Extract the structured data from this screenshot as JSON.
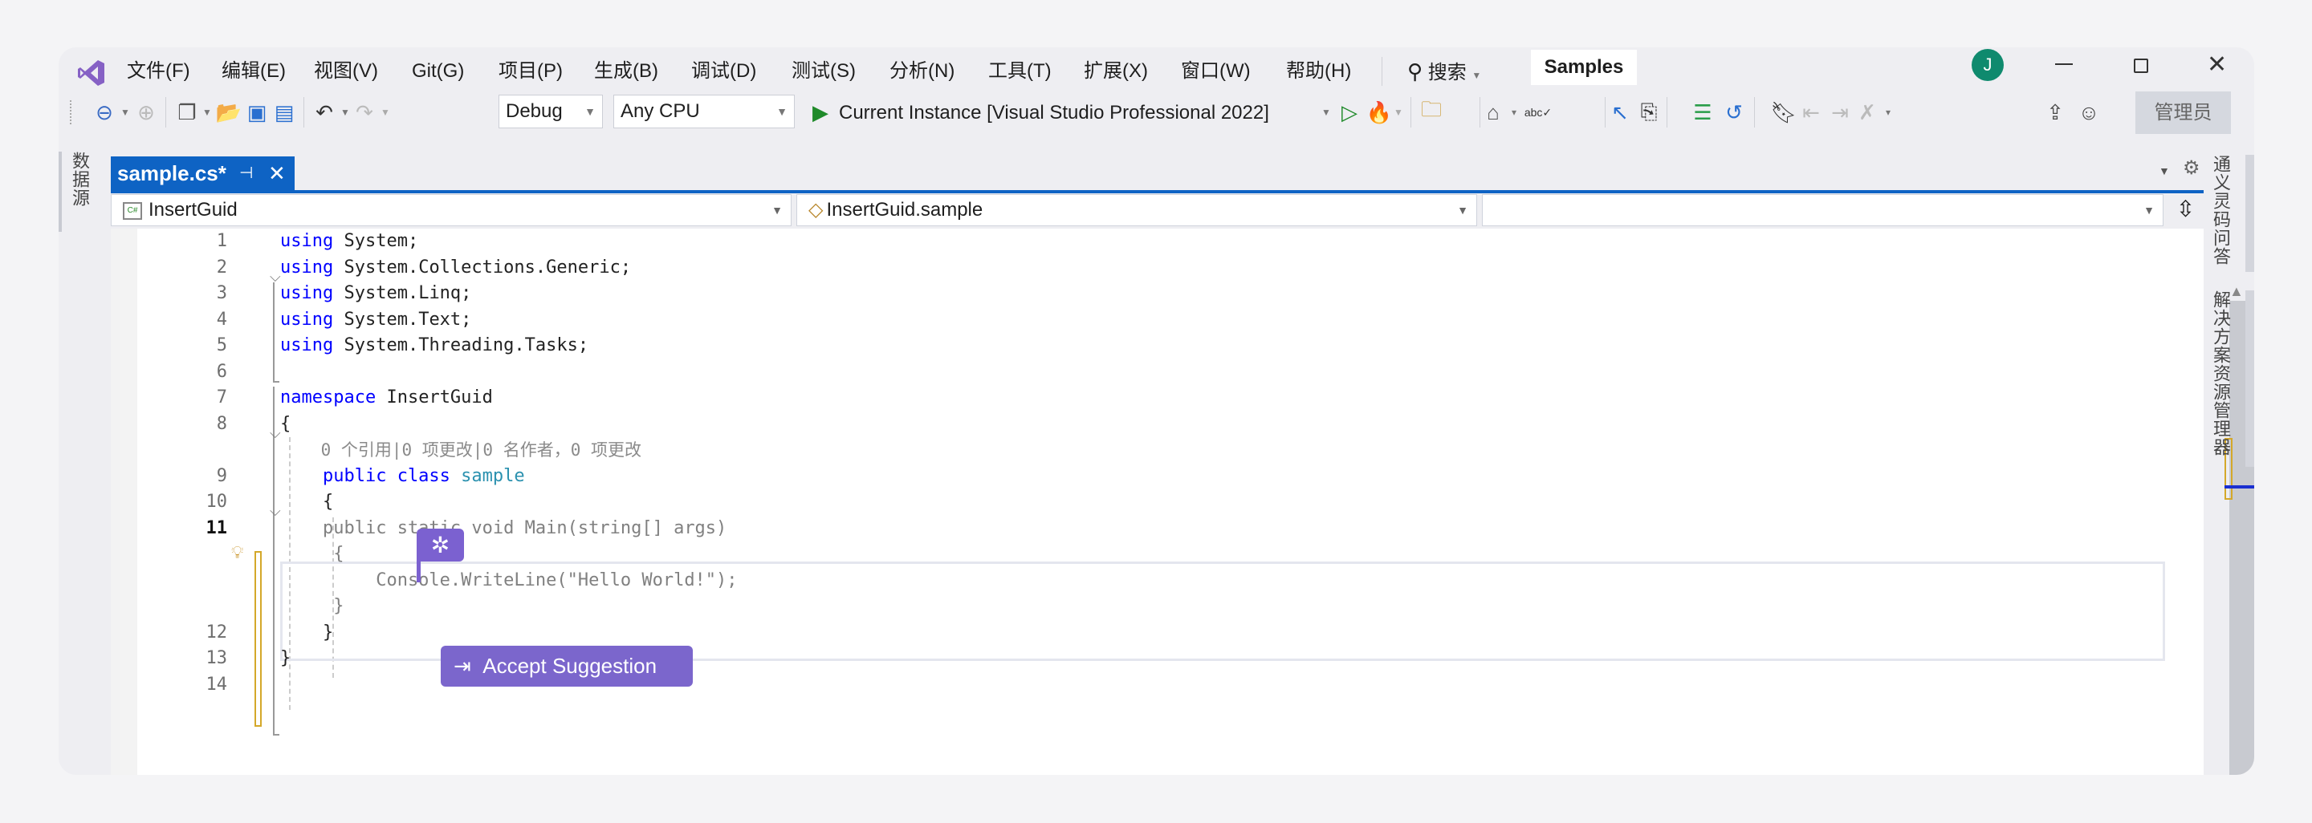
{
  "menu": {
    "items": [
      "文件(F)",
      "编辑(E)",
      "视图(V)",
      "Git(G)",
      "项目(P)",
      "生成(B)",
      "调试(D)",
      "测试(S)",
      "分析(N)",
      "工具(T)",
      "扩展(X)",
      "窗口(W)",
      "帮助(H)"
    ],
    "search": "搜索",
    "solution_name": "Samples",
    "avatar_initial": "J"
  },
  "toolbar": {
    "configuration": "Debug",
    "platform": "Any CPU",
    "start_target": "Current Instance [Visual Studio Professional 2022]",
    "admin_label": "管理员"
  },
  "left_panel": {
    "datasource_tab": "数据源"
  },
  "right_panel": {
    "tongyi_tab": "通义灵码问答",
    "solution_explorer_tab": "解决方案资源管理器"
  },
  "document_tab": {
    "label": "sample.cs*"
  },
  "nav_bar": {
    "project": "InsertGuid",
    "type": "InsertGuid.sample",
    "member": ""
  },
  "editor": {
    "rows": [
      {
        "n": "1",
        "tokens": [
          [
            "kw",
            "using"
          ],
          [
            "tx",
            " System;"
          ]
        ]
      },
      {
        "n": "2",
        "tokens": [
          [
            "kw",
            "using"
          ],
          [
            "tx",
            " System.Collections.Generic;"
          ]
        ]
      },
      {
        "n": "3",
        "tokens": [
          [
            "kw",
            "using"
          ],
          [
            "tx",
            " System.Linq;"
          ]
        ]
      },
      {
        "n": "4",
        "tokens": [
          [
            "kw",
            "using"
          ],
          [
            "tx",
            " System.Text;"
          ]
        ]
      },
      {
        "n": "5",
        "tokens": [
          [
            "kw",
            "using"
          ],
          [
            "tx",
            " System.Threading.Tasks;"
          ]
        ]
      },
      {
        "n": "6",
        "tokens": []
      },
      {
        "n": "7",
        "tokens": [
          [
            "kw",
            "namespace"
          ],
          [
            "tx",
            " InsertGuid"
          ]
        ]
      },
      {
        "n": "8",
        "tokens": [
          [
            "tx",
            "{"
          ]
        ]
      },
      {
        "n": "",
        "tokens": [
          [
            "cl",
            "    0 个引用|0 项更改|0 名作者，0 项更改"
          ]
        ]
      },
      {
        "n": "9",
        "tokens": [
          [
            "kw",
            "    public class "
          ],
          [
            "ty",
            "sample"
          ]
        ]
      },
      {
        "n": "10",
        "tokens": [
          [
            "tx",
            "    {"
          ]
        ]
      },
      {
        "n": "11",
        "tokens": [
          [
            "gh",
            "    public static void Main(string[] args)"
          ]
        ]
      },
      {
        "n": "",
        "tokens": [
          [
            "gh",
            "     {"
          ]
        ]
      },
      {
        "n": "",
        "tokens": [
          [
            "gh",
            "         Console.WriteLine(\"Hello World!\");"
          ]
        ]
      },
      {
        "n": "",
        "tokens": [
          [
            "gh",
            "     }"
          ]
        ]
      },
      {
        "n": "12",
        "tokens": [
          [
            "tx",
            "    }"
          ]
        ]
      },
      {
        "n": "13",
        "tokens": [
          [
            "tx",
            "}"
          ]
        ]
      },
      {
        "n": "14",
        "tokens": []
      }
    ]
  },
  "suggestion": {
    "accept_label": "Accept Suggestion",
    "accent": "#7b66cc"
  },
  "colors": {
    "tab_active": "#0e63c4",
    "keyword": "#0000ff",
    "type": "#2b91af",
    "change_marker": "#d4a82a",
    "avatar": "#0f8a6e"
  }
}
